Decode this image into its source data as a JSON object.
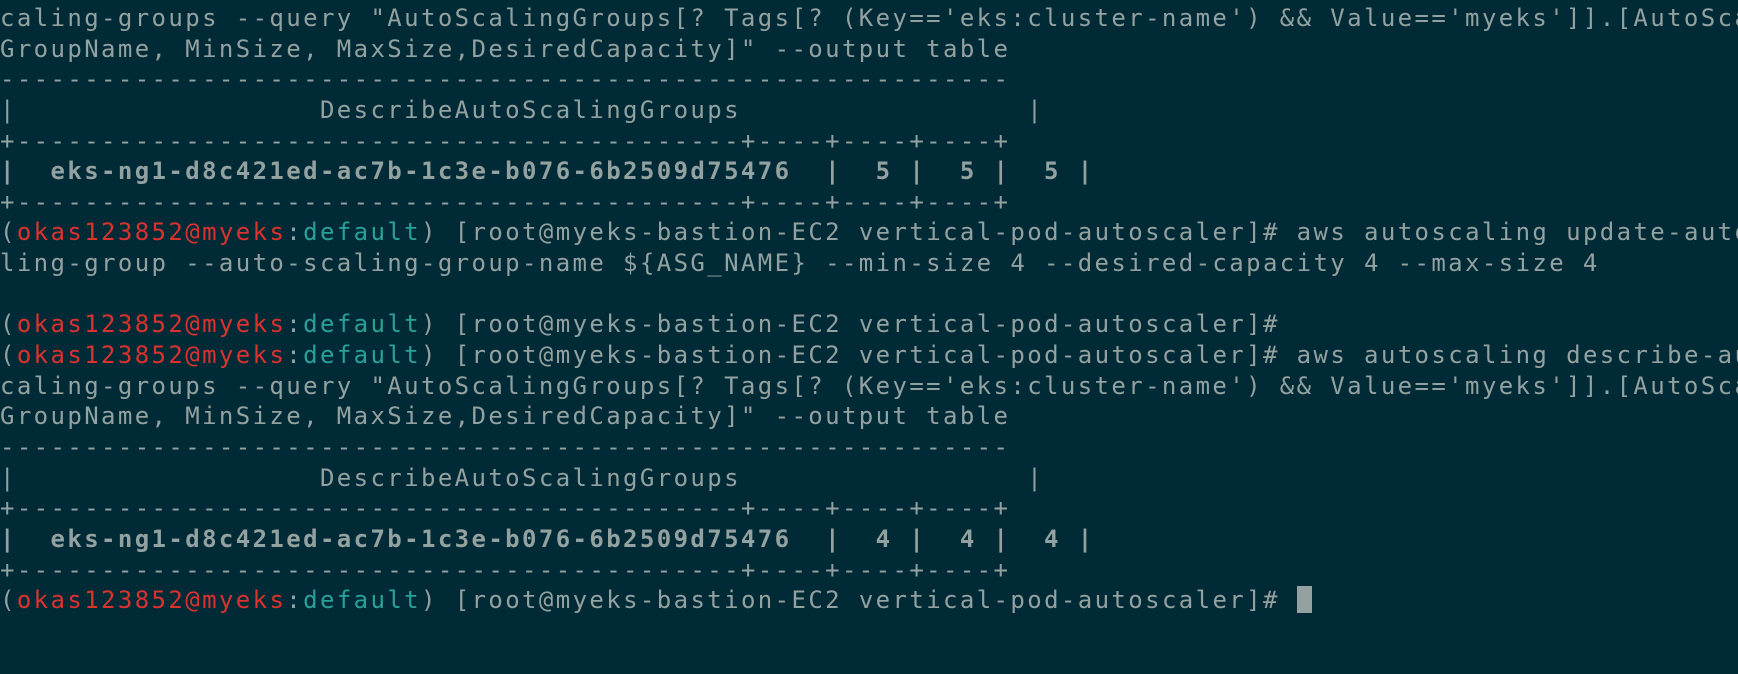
{
  "terminal": {
    "colors": {
      "background": "#002b36",
      "foreground": "#93a1a1",
      "user_host": "#dc322f",
      "namespace": "#2aa198"
    },
    "prompt": {
      "user": "okas123852",
      "host": "myeks",
      "namespace": "default",
      "cwd": "[root@myeks-bastion-EC2 vertical-pod-autoscaler]#"
    },
    "lines": {
      "l1": "caling-groups --query \"AutoScalingGroups[? Tags[? (Key=='eks:cluster-name') && Value=='myeks']].[AutoScaling",
      "l2": "GroupName, MinSize, MaxSize,DesiredCapacity]\" --output table",
      "l3": "------------------------------------------------------------",
      "l4": "|                  DescribeAutoScalingGroups                 |",
      "l5": "+-------------------------------------------+----+----+----+",
      "l6": "|  eks-ng1-d8c421ed-ac7b-1c3e-b076-6b2509d75476  |  5 |  5 |  5 |",
      "l7": "+-------------------------------------------+----+----+----+",
      "l8_cmd": "aws autoscaling update-auto-sca",
      "l9": "ling-group --auto-scaling-group-name ${ASG_NAME} --min-size 4 --desired-capacity 4 --max-size 4",
      "l11_cmd": "",
      "l12_cmd": "aws autoscaling describe-auto-s",
      "l13": "caling-groups --query \"AutoScalingGroups[? Tags[? (Key=='eks:cluster-name') && Value=='myeks']].[AutoScaling",
      "l14": "GroupName, MinSize, MaxSize,DesiredCapacity]\" --output table",
      "l15": "------------------------------------------------------------",
      "l16": "|                  DescribeAutoScalingGroups                 |",
      "l17": "+-------------------------------------------+----+----+----+",
      "l18": "|  eks-ng1-d8c421ed-ac7b-1c3e-b076-6b2509d75476  |  4 |  4 |  4 |",
      "l19": "+-------------------------------------------+----+----+----+",
      "l20_cmd": ""
    }
  }
}
